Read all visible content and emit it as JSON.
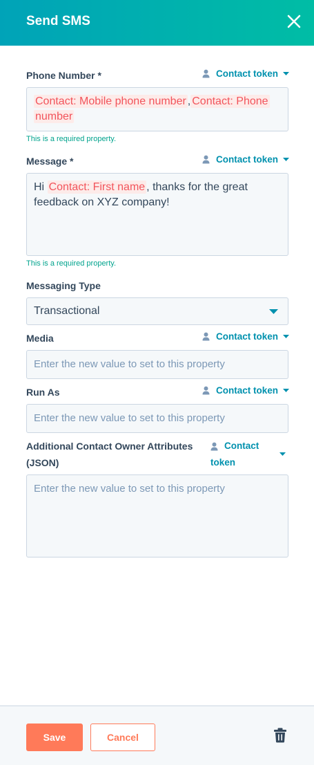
{
  "header": {
    "title": "Send SMS"
  },
  "token_label": "Contact token",
  "token_label_line1": "Contact",
  "token_label_line2": "token",
  "phone": {
    "label": "Phone Number *",
    "tokens": [
      "Contact: Mobile phone number",
      "Contact: Phone",
      "number"
    ],
    "separator": ",",
    "help": "This is a required property."
  },
  "message": {
    "label": "Message *",
    "prefix": "Hi ",
    "token": "Contact: First name",
    "suffix_line1": ", thanks for the great",
    "line2": "feedback on XYZ company!",
    "help": "This is a required property."
  },
  "messaging_type": {
    "label": "Messaging Type",
    "value": "Transactional"
  },
  "media": {
    "label": "Media",
    "placeholder": "Enter the new value to set to this property"
  },
  "run_as": {
    "label": "Run As",
    "placeholder": "Enter the new value to set to this property"
  },
  "additional": {
    "label_line1": "Additional Contact Owner Attributes",
    "label_line2": "(JSON)",
    "placeholder": "Enter the new value to set to this property"
  },
  "footer": {
    "save_label": "Save",
    "cancel_label": "Cancel"
  },
  "colors": {
    "accent": "#ff7a59",
    "token_link": "#0091ae",
    "header_start": "#00a3b8",
    "header_end": "#00bda5",
    "required_help": "#00a38d"
  }
}
